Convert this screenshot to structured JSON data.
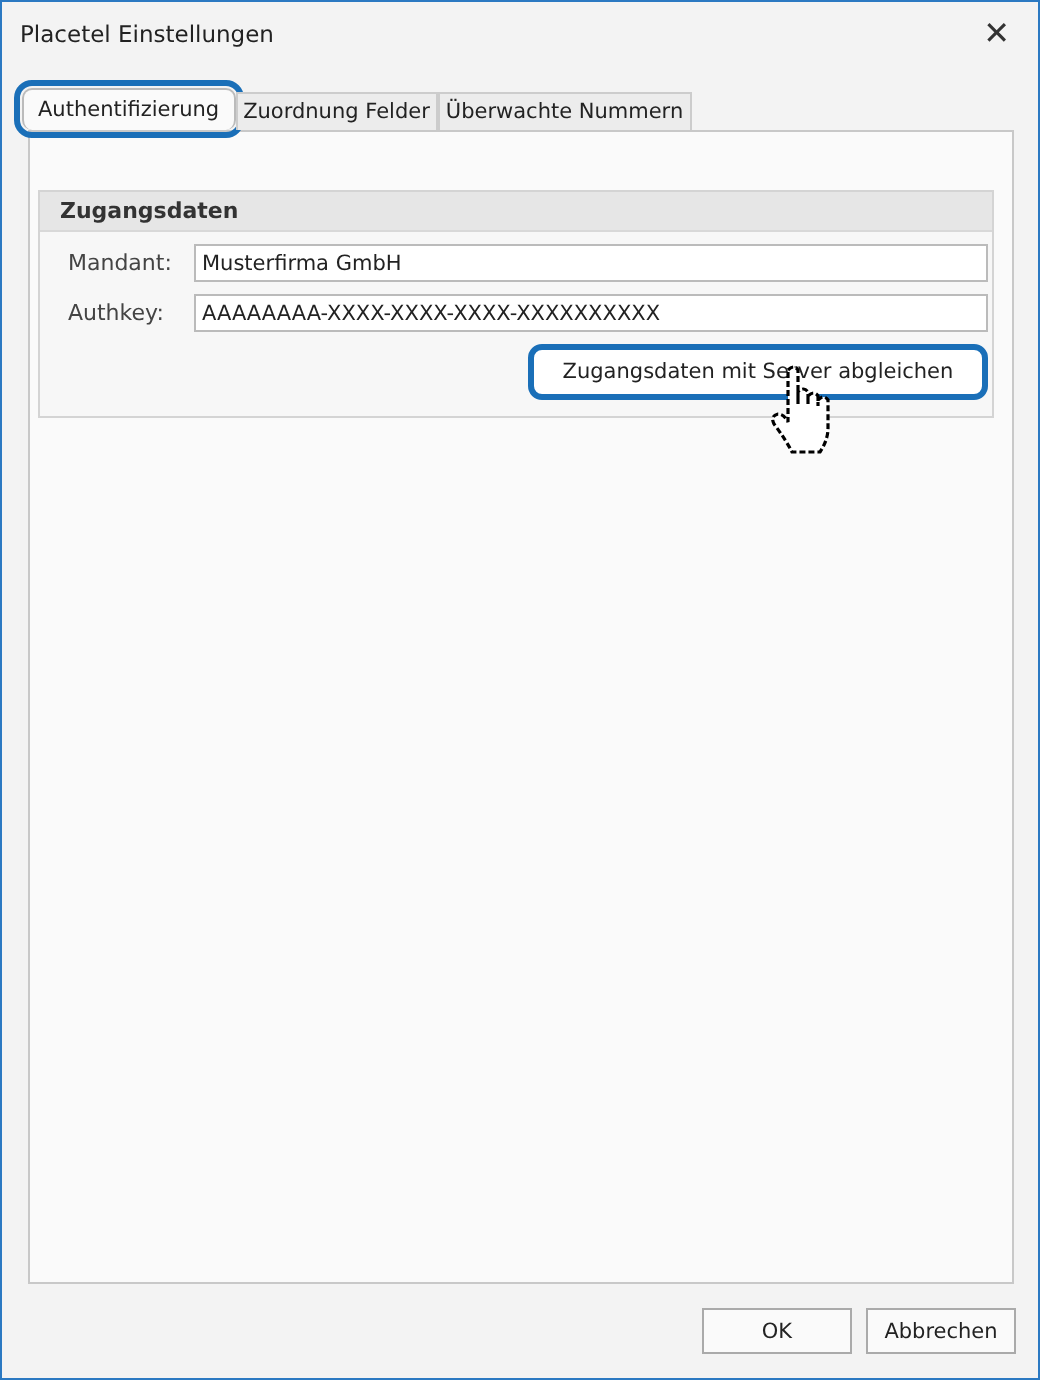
{
  "window": {
    "title": "Placetel Einstellungen",
    "close": "✕"
  },
  "tabs": [
    {
      "label": "Authentifizierung",
      "selected": true,
      "highlighted": true
    },
    {
      "label": "Zuordnung Felder",
      "selected": false,
      "highlighted": false
    },
    {
      "label": "Überwachte Nummern",
      "selected": false,
      "highlighted": false
    }
  ],
  "group": {
    "title": "Zugangsdaten",
    "fields": [
      {
        "label": "Mandant:",
        "value": "Musterfirma GmbH"
      },
      {
        "label": "Authkey:",
        "value": "AAAAAAAA-XXXX-XXXX-XXXX-XXXXXXXXXX"
      }
    ],
    "action": {
      "label": "Zugangsdaten mit Server abgleichen",
      "highlighted": true
    }
  },
  "buttons": [
    "OK",
    "Abbrechen"
  ]
}
